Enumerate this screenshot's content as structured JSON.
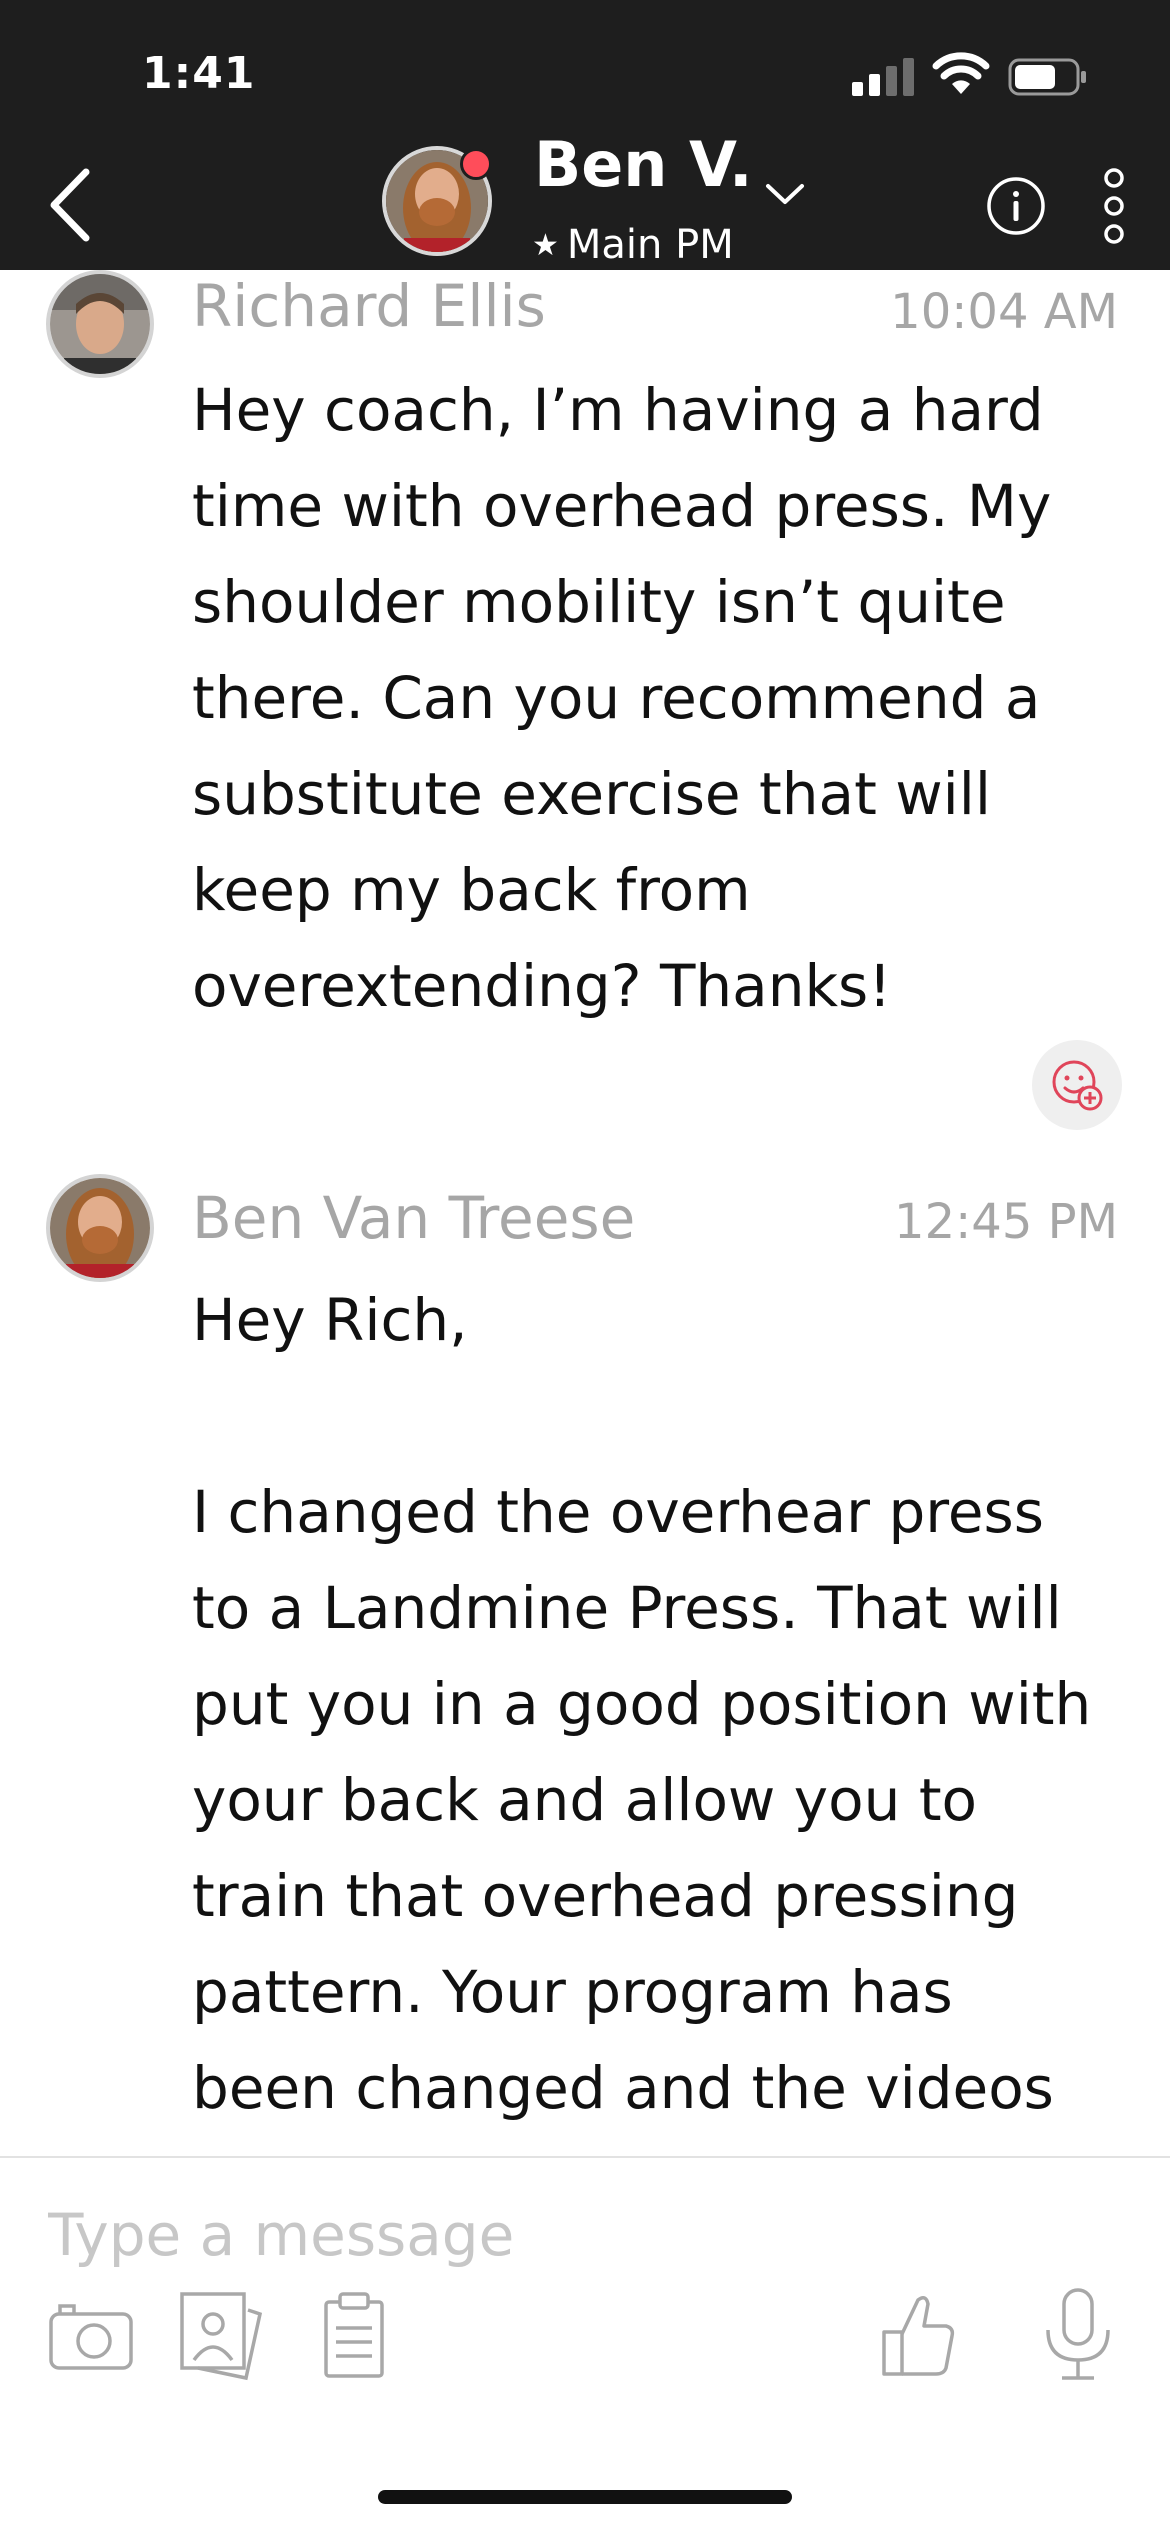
{
  "status_bar": {
    "time": "1:41",
    "signal_icon": "signal-bars-icon",
    "wifi_icon": "wifi-icon",
    "battery_icon": "battery-icon"
  },
  "header": {
    "back_icon": "chevron-left-icon",
    "name": "Ben V.",
    "subtitle": "Main PM",
    "subtitle_icon": "star-icon",
    "dropdown_icon": "chevron-down-icon",
    "info_icon": "info-icon",
    "more_icon": "more-vertical-icon",
    "online_color": "#ff4d5a",
    "background": "#1e1e1e"
  },
  "messages": [
    {
      "sender": "Richard Ellis",
      "time": "10:04 AM",
      "text": "Hey coach, I’m having a hard\ntime with overhead press. My\nshoulder mobility isn’t quite\nthere. Can you recommend a\nsubstitute exercise that will\nkeep my back from\noverextending? Thanks!"
    },
    {
      "sender": "Ben Van Treese",
      "time": "12:45 PM",
      "text": "Hey Rich,\n\nI changed the overhear press\nto a Landmine Press. That will\nput you in a good position with\nyour back and allow you to\ntrain that overhead pressing\npattern. Your program has\nbeen changed and the videos"
    }
  ],
  "reaction_icon": "add-reaction-icon",
  "composer": {
    "placeholder": "Type a message",
    "tools": [
      "camera-icon",
      "photo-library-icon",
      "clipboard-icon",
      "thumbs-up-icon",
      "microphone-icon"
    ]
  }
}
